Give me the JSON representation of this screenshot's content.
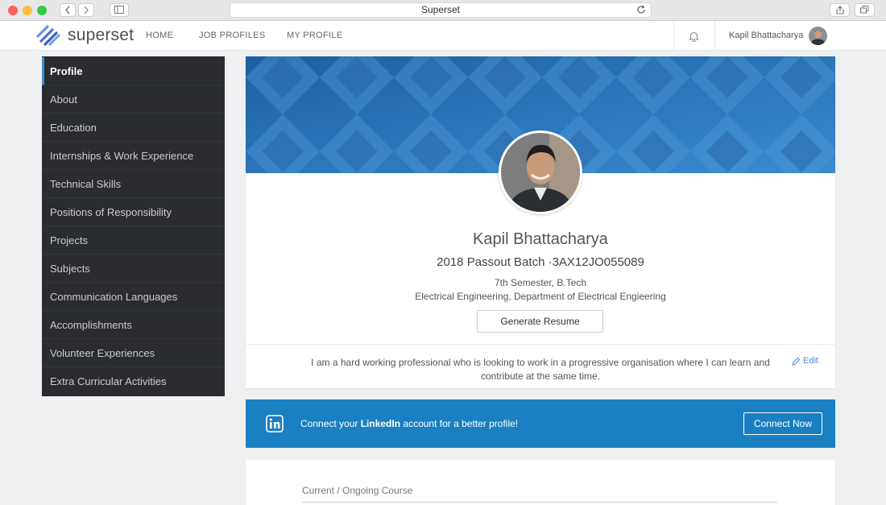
{
  "window": {
    "url_title": "Superset"
  },
  "nav": {
    "brand": "superset",
    "links": [
      "HOME",
      "JOB PROFILES",
      "MY PROFILE"
    ],
    "user_name": "Kapil Bhattacharya"
  },
  "sidebar": {
    "items": [
      "Profile",
      "About",
      "Education",
      "Internships & Work Experience",
      "Technical Skills",
      "Positions of Responsibility",
      "Projects",
      "Subjects",
      "Communication Languages",
      "Accomplishments",
      "Volunteer Experiences",
      "Extra Curricular Activities"
    ],
    "active_index": 0
  },
  "profile": {
    "name": "Kapil Bhattacharya",
    "batch": "2018 Passout Batch ·3AX12JO055089",
    "semester": "7th Semester, B.Tech",
    "department": "Electrical Engineering, Department of Electrical Engieering",
    "generate_label": "Generate Resume",
    "bio": "I am a hard working professional who is looking to work in a progressive organisation where I can learn and contribute at the same time.",
    "edit_label": "Edit"
  },
  "linkedin": {
    "text_before": "Connect your ",
    "text_bold": "LinkedIn",
    "text_after": " account for a better profile!",
    "button_label": "Connect Now"
  },
  "course": {
    "label": "Current / Ongoing Course"
  },
  "colors": {
    "accent": "#1b80c2",
    "sidebar_bg": "#2a2c30",
    "active_indicator": "#3d8fd1",
    "banner_base": "#2b74b8"
  }
}
